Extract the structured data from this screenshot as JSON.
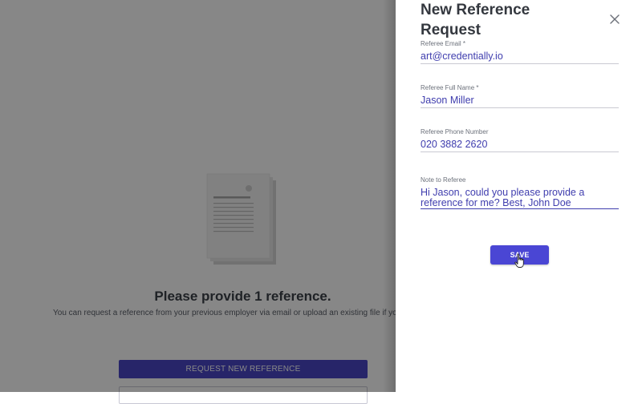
{
  "background": {
    "title": "Please provide 1 reference.",
    "subtitle": "You can request a reference from your previous employer via email or upload an existing file if you",
    "request_button_label": "REQUEST NEW REFERENCE"
  },
  "drawer": {
    "title": "New Reference Request",
    "close_icon": "close-icon",
    "fields": [
      {
        "label": "Referee Email *",
        "value": "art@credentially.io"
      },
      {
        "label": "Referee Full Name *",
        "value": "Jason Miller"
      },
      {
        "label": "Referee Phone Number",
        "value": "020 3882 2620"
      },
      {
        "label": "Note to Referee",
        "value": "Hi Jason, could you please provide a reference for me? Best, John Doe"
      }
    ],
    "save_label": "SAVE"
  },
  "colors": {
    "accent": "#4a46d4",
    "input_text": "#3f3dae",
    "overlay": "rgba(0,0,0,0.47)"
  }
}
